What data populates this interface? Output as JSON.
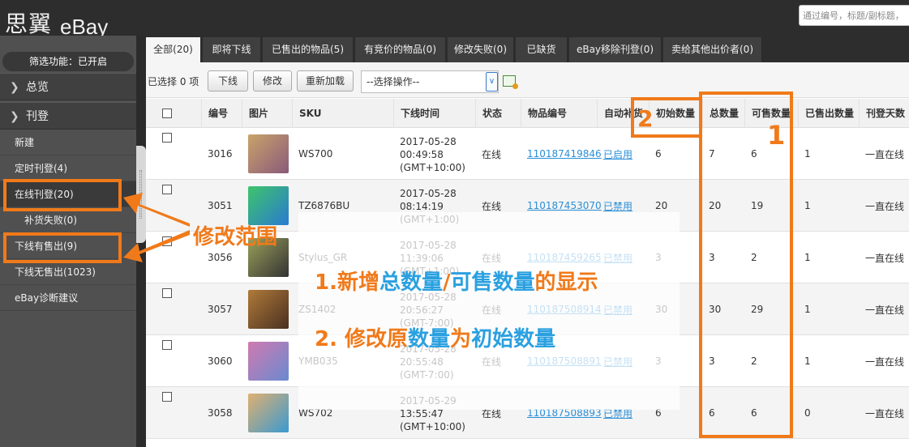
{
  "header": {
    "logo_cn": "思翼",
    "logo_en": "eBay",
    "search_placeholder": "通过编号，标题/副标题，"
  },
  "sidebar": {
    "filter_status": "筛选功能：已开启",
    "sections": [
      {
        "label": "总览",
        "icon": "chevron-right-icon"
      },
      {
        "label": "刊登",
        "icon": "chevron-right-icon"
      }
    ],
    "items": [
      {
        "label": "新建"
      },
      {
        "label": "定时刊登(4)"
      },
      {
        "label": "在线刊登(20)"
      },
      {
        "label": "补货失败(0)"
      },
      {
        "label": "下线有售出(9)"
      },
      {
        "label": "下线无售出(1023)"
      },
      {
        "label": "eBay诊断建议"
      }
    ]
  },
  "tabs": [
    {
      "label": "全部(20)",
      "active": true
    },
    {
      "label": "即将下线"
    },
    {
      "label": "已售出的物品(5)"
    },
    {
      "label": "有竞价的物品(0)"
    },
    {
      "label": "修改失败(0)"
    },
    {
      "label": "已缺货"
    },
    {
      "label": "eBay移除刊登(0)"
    },
    {
      "label": "卖给其他出价者(0)"
    }
  ],
  "toolbar": {
    "selected": "已选择 0 项",
    "offline": "下线",
    "edit": "修改",
    "reload": "重新加载",
    "action_select": "--选择操作--"
  },
  "table": {
    "columns": [
      "编号",
      "图片",
      "SKU",
      "下线时间",
      "状态",
      "物品编号",
      "自动补货",
      "初始数量",
      "总数量",
      "可售数量",
      "已售出数量",
      "刊登天数"
    ],
    "rows": [
      {
        "id": "3016",
        "sku": "WS700",
        "date": "2017-05-28",
        "time": "00:49:58",
        "tz": "(GMT+10:00)",
        "status": "在线",
        "item_no": "110187419846",
        "auto": "已启用",
        "initial": "6",
        "total": "7",
        "available": "6",
        "sold": "1",
        "days": "一直在线",
        "thumb": [
          "#c9a36a",
          "#8a5a7a"
        ]
      },
      {
        "id": "3051",
        "sku": "TZ6876BU",
        "date": "2017-05-28",
        "time": "08:14:19",
        "tz": "(GMT+1:00)",
        "status": "在线",
        "item_no": "110187453070",
        "auto": "已禁用",
        "initial": "20",
        "total": "20",
        "available": "19",
        "sold": "1",
        "days": "一直在线",
        "thumb": [
          "#3ec46a",
          "#2a7ad0"
        ]
      },
      {
        "id": "3056",
        "sku": "Stylus_GR",
        "date": "2017-05-28",
        "time": "11:39:06",
        "tz": "(GMT+1:00)",
        "status": "在线",
        "item_no": "110187459265",
        "auto": "已禁用",
        "initial": "3",
        "total": "3",
        "available": "2",
        "sold": "1",
        "days": "一直在线",
        "thumb": [
          "#9aa05a",
          "#333333"
        ]
      },
      {
        "id": "3057",
        "sku": "ZS1402",
        "date": "2017-05-28",
        "time": "20:56:27",
        "tz": "(GMT-7:00)",
        "status": "在线",
        "item_no": "110187508914",
        "auto": "已禁用",
        "initial": "30",
        "total": "30",
        "available": "29",
        "sold": "1",
        "days": "一直在线",
        "thumb": [
          "#b07a3a",
          "#4a3020"
        ]
      },
      {
        "id": "3060",
        "sku": "YMB035",
        "date": "2017-05-28",
        "time": "20:55:48",
        "tz": "(GMT-7:00)",
        "status": "在线",
        "item_no": "110187508891",
        "auto": "已禁用",
        "initial": "3",
        "total": "3",
        "available": "2",
        "sold": "1",
        "days": "一直在线",
        "thumb": [
          "#d07ab0",
          "#6a8ad0"
        ]
      },
      {
        "id": "3058",
        "sku": "WS702",
        "date": "2017-05-29",
        "time": "13:55:47",
        "tz": "(GMT+10:00)",
        "status": "在线",
        "item_no": "110187508893",
        "auto": "已禁用",
        "initial": "6",
        "total": "6",
        "available": "6",
        "sold": "0",
        "days": "一直在线",
        "thumb": [
          "#e0b070",
          "#3a9ad0"
        ]
      }
    ]
  },
  "annotations": {
    "marker_1": "1",
    "marker_2": "2",
    "edit_scope": "修改范围",
    "note1_prefix": "1.新增",
    "note1_total": "总数量",
    "note1_slash": "/",
    "note1_available": "可售数量",
    "note1_suffix": "的显示",
    "note2_prefix": "2. 修改原",
    "note2_qty": "数量",
    "note2_mid": "为",
    "note2_initial": "初始数量"
  },
  "colors": {
    "annotation_orange": "#f07a1a",
    "annotation_blue": "#2aa0e0",
    "link_blue": "#2a8fd8"
  }
}
